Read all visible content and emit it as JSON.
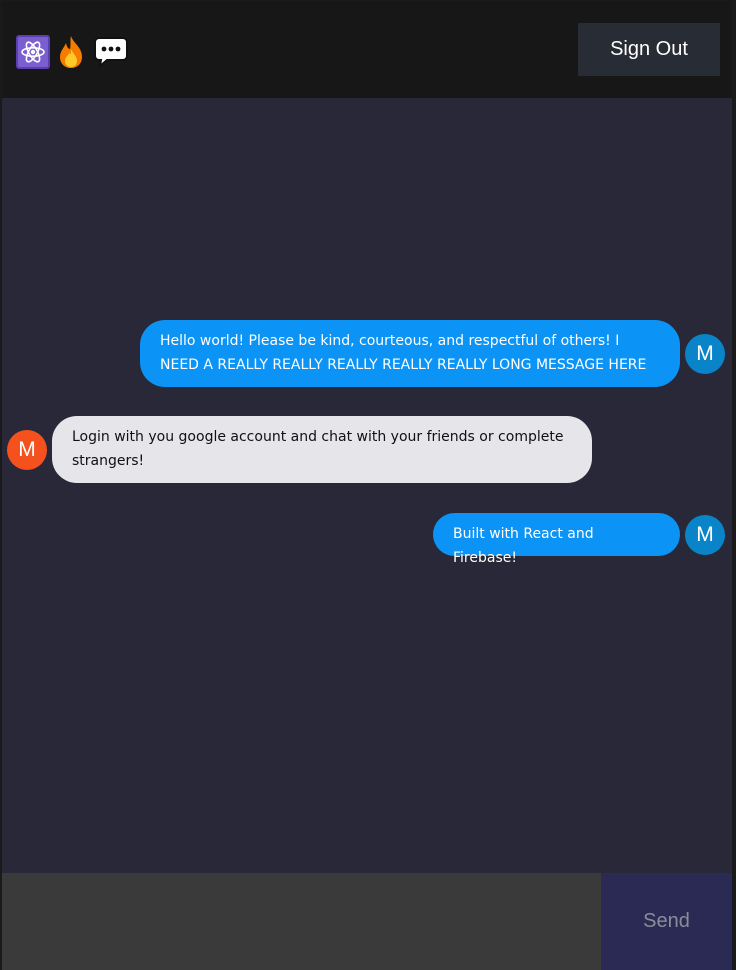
{
  "header": {
    "icons": [
      "atom-icon",
      "fire-icon",
      "speech-balloon-icon"
    ],
    "sign_out_label": "Sign Out"
  },
  "messages": [
    {
      "type": "sent",
      "text": "Hello world! Please be kind, courteous, and respectful of others! I NEED A REALLY REALLY REALLY REALLY REALLY LONG MESSAGE HERE",
      "avatar_letter": "M",
      "avatar_color": "#0a84c8"
    },
    {
      "type": "received",
      "text": "Login with you google account and chat with your friends or complete strangers!",
      "avatar_letter": "M",
      "avatar_color": "#f4511e"
    },
    {
      "type": "sent",
      "text": "Built with React and Firebase!",
      "avatar_letter": "M",
      "avatar_color": "#0a84c8"
    }
  ],
  "composer": {
    "input_value": "",
    "send_label": "Send"
  },
  "colors": {
    "sent_bubble": "#0b93f6",
    "received_bubble": "#e5e5ea",
    "background": "#282838",
    "header": "#181717"
  }
}
